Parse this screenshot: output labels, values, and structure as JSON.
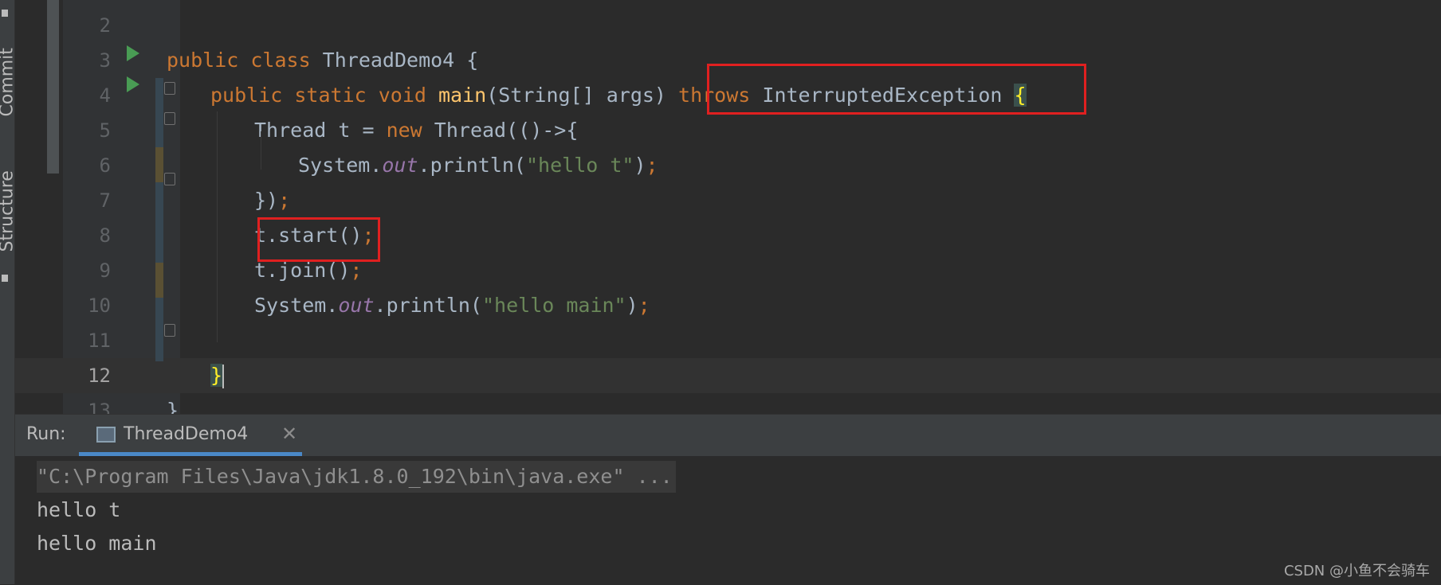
{
  "side_tabs": {
    "commit": "Commit",
    "structure": "Structure"
  },
  "editor": {
    "lines": [
      {
        "num": "2"
      },
      {
        "num": "3",
        "tokens": [
          [
            "kw",
            "public class "
          ],
          [
            "",
            "ThreadDemo4 {"
          ]
        ]
      },
      {
        "num": "4",
        "tokens": [
          [
            "kw",
            "public static void "
          ],
          [
            "fn",
            "main"
          ],
          [
            "",
            "(String[] args) "
          ],
          [
            "kw",
            "throws "
          ],
          [
            "",
            "InterruptedException "
          ]
        ],
        "brace": "{"
      },
      {
        "num": "5",
        "tokens": [
          [
            "",
            "Thread t = "
          ],
          [
            "kw",
            "new "
          ],
          [
            "",
            "Thread(()->{"
          ]
        ]
      },
      {
        "num": "6",
        "tokens": [
          [
            "",
            "System."
          ],
          [
            "st",
            "out"
          ],
          [
            "",
            ".println("
          ],
          [
            "str",
            "\"hello t\""
          ],
          [
            "",
            ")"
          ],
          [
            "kw",
            ";"
          ]
        ]
      },
      {
        "num": "7",
        "tokens": [
          [
            "",
            "})"
          ],
          [
            "kw",
            ";"
          ]
        ]
      },
      {
        "num": "8",
        "tokens": [
          [
            "",
            "t.start()"
          ],
          [
            "kw",
            ";"
          ]
        ]
      },
      {
        "num": "9",
        "tokens": [
          [
            "",
            "t.join()"
          ],
          [
            "kw",
            ";"
          ]
        ]
      },
      {
        "num": "10",
        "tokens": [
          [
            "",
            "System."
          ],
          [
            "st",
            "out"
          ],
          [
            "",
            ".println("
          ],
          [
            "str",
            "\"hello main\""
          ],
          [
            "",
            ")"
          ],
          [
            "kw",
            ";"
          ]
        ]
      },
      {
        "num": "11"
      },
      {
        "num": "12",
        "brace": "}"
      },
      {
        "num": "13",
        "tokens": [
          [
            "",
            "}"
          ]
        ]
      }
    ]
  },
  "run_panel": {
    "label": "Run:",
    "tab_label": "ThreadDemo4",
    "close_symbol": "✕",
    "console": [
      "\"C:\\Program Files\\Java\\jdk1.8.0_192\\bin\\java.exe\" ...",
      "hello t",
      "hello main"
    ]
  },
  "watermark": "CSDN @小鱼不会骑车"
}
